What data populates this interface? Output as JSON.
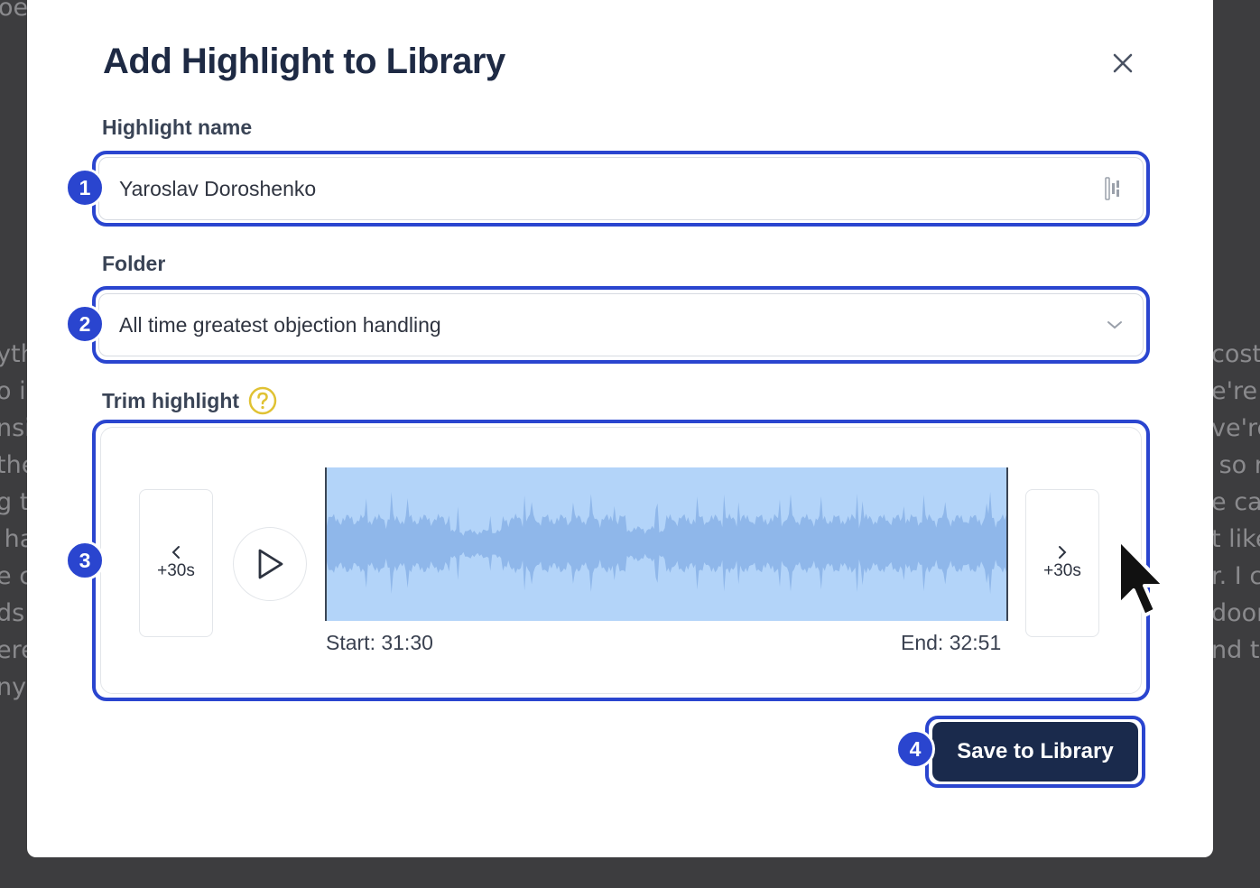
{
  "dialog": {
    "title": "Add Highlight to Library",
    "close_icon": "close-icon"
  },
  "background_text": {
    "left_lines": [
      "oe",
      "",
      "",
      "",
      "",
      "",
      "",
      "",
      "",
      "yth",
      "o in",
      "nsi",
      "the",
      "g t",
      " ha",
      "e c",
      "ds",
      "ere",
      "ny"
    ],
    "right_lines": [
      "cost",
      "e're",
      "ve're",
      " so r",
      "e ca",
      "t like",
      "r. I c",
      "door",
      "nd th"
    ],
    "top_text": "oe"
  },
  "fields": {
    "name_label": "Highlight name",
    "name_value": "Yaroslav Doroshenko",
    "folder_label": "Folder",
    "folder_value": "All time greatest objection handling",
    "trim_label": "Trim highlight"
  },
  "trim": {
    "back_label": "+30s",
    "forward_label": "+30s",
    "start_label": "Start: 31:30",
    "end_label": "End: 32:51",
    "waveform_color": "#8fb7ea",
    "selection_color": "#b3d4f9"
  },
  "actions": {
    "save_label": "Save to Library"
  },
  "annotations": {
    "badge_1": "1",
    "badge_2": "2",
    "badge_3": "3",
    "badge_4": "4",
    "color": "#2a45cf"
  },
  "colors": {
    "title": "#1e2a44",
    "primary_button": "#1a2a4c",
    "help_icon": "#e0c233"
  }
}
